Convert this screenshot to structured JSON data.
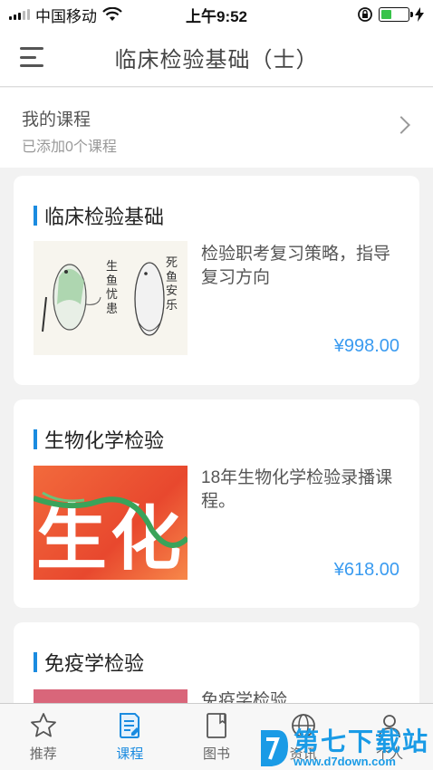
{
  "status_bar": {
    "carrier": "中国移动",
    "time": "上午9:52"
  },
  "nav": {
    "title": "临床检验基础（士）"
  },
  "my_courses": {
    "title": "我的课程",
    "subtitle": "已添加0个课程"
  },
  "courses": [
    {
      "title": "临床检验基础",
      "description": "检验职考复习策略，指导复习方向",
      "price": "¥998.00",
      "thumb_text_left": "生鱼忧患",
      "thumb_text_right": "死鱼安乐"
    },
    {
      "title": "生物化学检验",
      "description": "18年生物化学检验录播课程。",
      "price": "¥618.00",
      "thumb_text": "生化"
    },
    {
      "title": "免疫学检验",
      "description": "免疫学检验"
    }
  ],
  "tabs": [
    {
      "label": "推荐",
      "icon": "star-icon"
    },
    {
      "label": "课程",
      "icon": "course-book-icon",
      "active": true
    },
    {
      "label": "图书",
      "icon": "book-icon"
    },
    {
      "label": "资讯",
      "icon": "globe-icon"
    },
    {
      "label": "个人",
      "icon": "person-icon"
    }
  ],
  "watermark": {
    "name": "第七下载站",
    "url": "www.d7down.com"
  },
  "colors": {
    "accent": "#1a8be0",
    "price": "#3a9bf0",
    "battery": "#38c34a"
  }
}
